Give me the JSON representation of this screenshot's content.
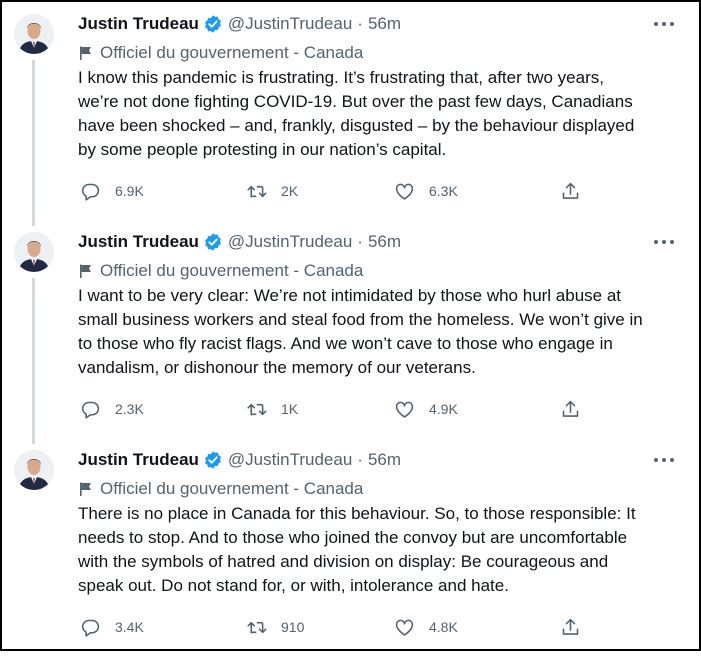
{
  "tweets": [
    {
      "author": {
        "name": "Justin Trudeau",
        "handle": "@JustinTrudeau",
        "separator": "·",
        "time": "56m"
      },
      "label": "Officiel du gouvernement - Canada",
      "text_lines": [
        "I know this pandemic is frustrating. It’s frustrating that, after two years,",
        "we’re not done fighting COVID-19. But over the past few days, Canadians",
        "have been shocked – and, frankly, disgusted – by the behaviour displayed",
        "by some people protesting in our nation’s capital."
      ],
      "replies": "6.9K",
      "retweets": "2K",
      "likes": "6.3K"
    },
    {
      "author": {
        "name": "Justin Trudeau",
        "handle": "@JustinTrudeau",
        "separator": "·",
        "time": "56m"
      },
      "label": "Officiel du gouvernement - Canada",
      "text_lines": [
        "I want to be very clear: We’re not intimidated by those who hurl abuse at",
        "small business workers and steal food from the homeless. We won’t give in",
        "to those who fly racist flags. And we won’t cave to those who engage in",
        "vandalism, or dishonour the memory of our veterans."
      ],
      "replies": "2.3K",
      "retweets": "1K",
      "likes": "4.9K"
    },
    {
      "author": {
        "name": "Justin Trudeau",
        "handle": "@JustinTrudeau",
        "separator": "·",
        "time": "56m"
      },
      "label": "Officiel du gouvernement - Canada",
      "text_lines": [
        "There is no place in Canada for this behaviour. So, to those responsible: It",
        "needs to stop. And to those who joined the convoy but are uncomfortable",
        "with the symbols of hatred and division on display: Be courageous and",
        "speak out. Do not stand for, or with, intolerance and hate."
      ],
      "replies": "3.4K",
      "retweets": "910",
      "likes": "4.8K"
    }
  ],
  "icons": {
    "verified": "verified-badge-icon",
    "label": "flag-icon",
    "reply": "reply-icon",
    "retweet": "retweet-icon",
    "like": "heart-icon",
    "share": "share-icon",
    "more": "more-options-icon"
  },
  "colors": {
    "verified": "#1d9bf0",
    "secondary_text": "#536471",
    "thread_line": "#cfd9de",
    "text": "#0f1419"
  }
}
